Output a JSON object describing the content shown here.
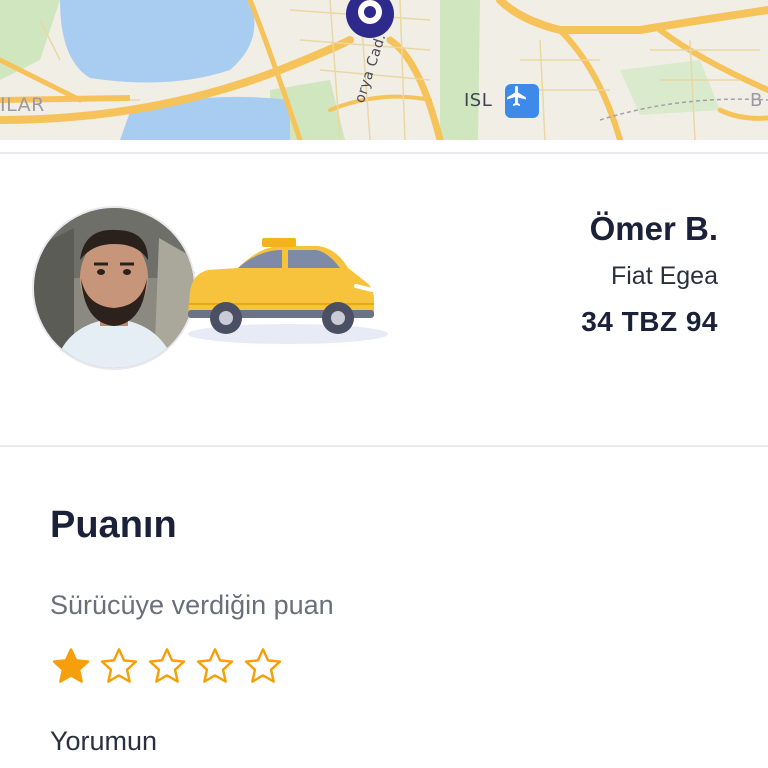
{
  "map": {
    "labels": {
      "district_left": "ILAR",
      "airport_code": "ISL",
      "district_right": "B",
      "street": "orya Cad."
    },
    "icons": {
      "airport": "airplane-icon",
      "pin": "destination-pin-icon"
    },
    "colors": {
      "road": "#f6c35b",
      "water": "#a9cdf1",
      "green": "#cfe6bf",
      "land": "#f1eee6",
      "pin": "#2d2a8c"
    }
  },
  "driver": {
    "name": "Ömer B.",
    "car_model": "Fiat Egea",
    "plate": "34 TBZ 94",
    "avatar_icon": "driver-avatar",
    "car_icon": "taxi-car-icon",
    "colors": {
      "taxi": "#f7c23c"
    }
  },
  "rating": {
    "title": "Puanın",
    "subtitle": "Sürücüye verdiğin puan",
    "score": 1,
    "max": 5,
    "colors": {
      "star": "#f59f0c"
    }
  },
  "comment": {
    "label": "Yorumun"
  }
}
